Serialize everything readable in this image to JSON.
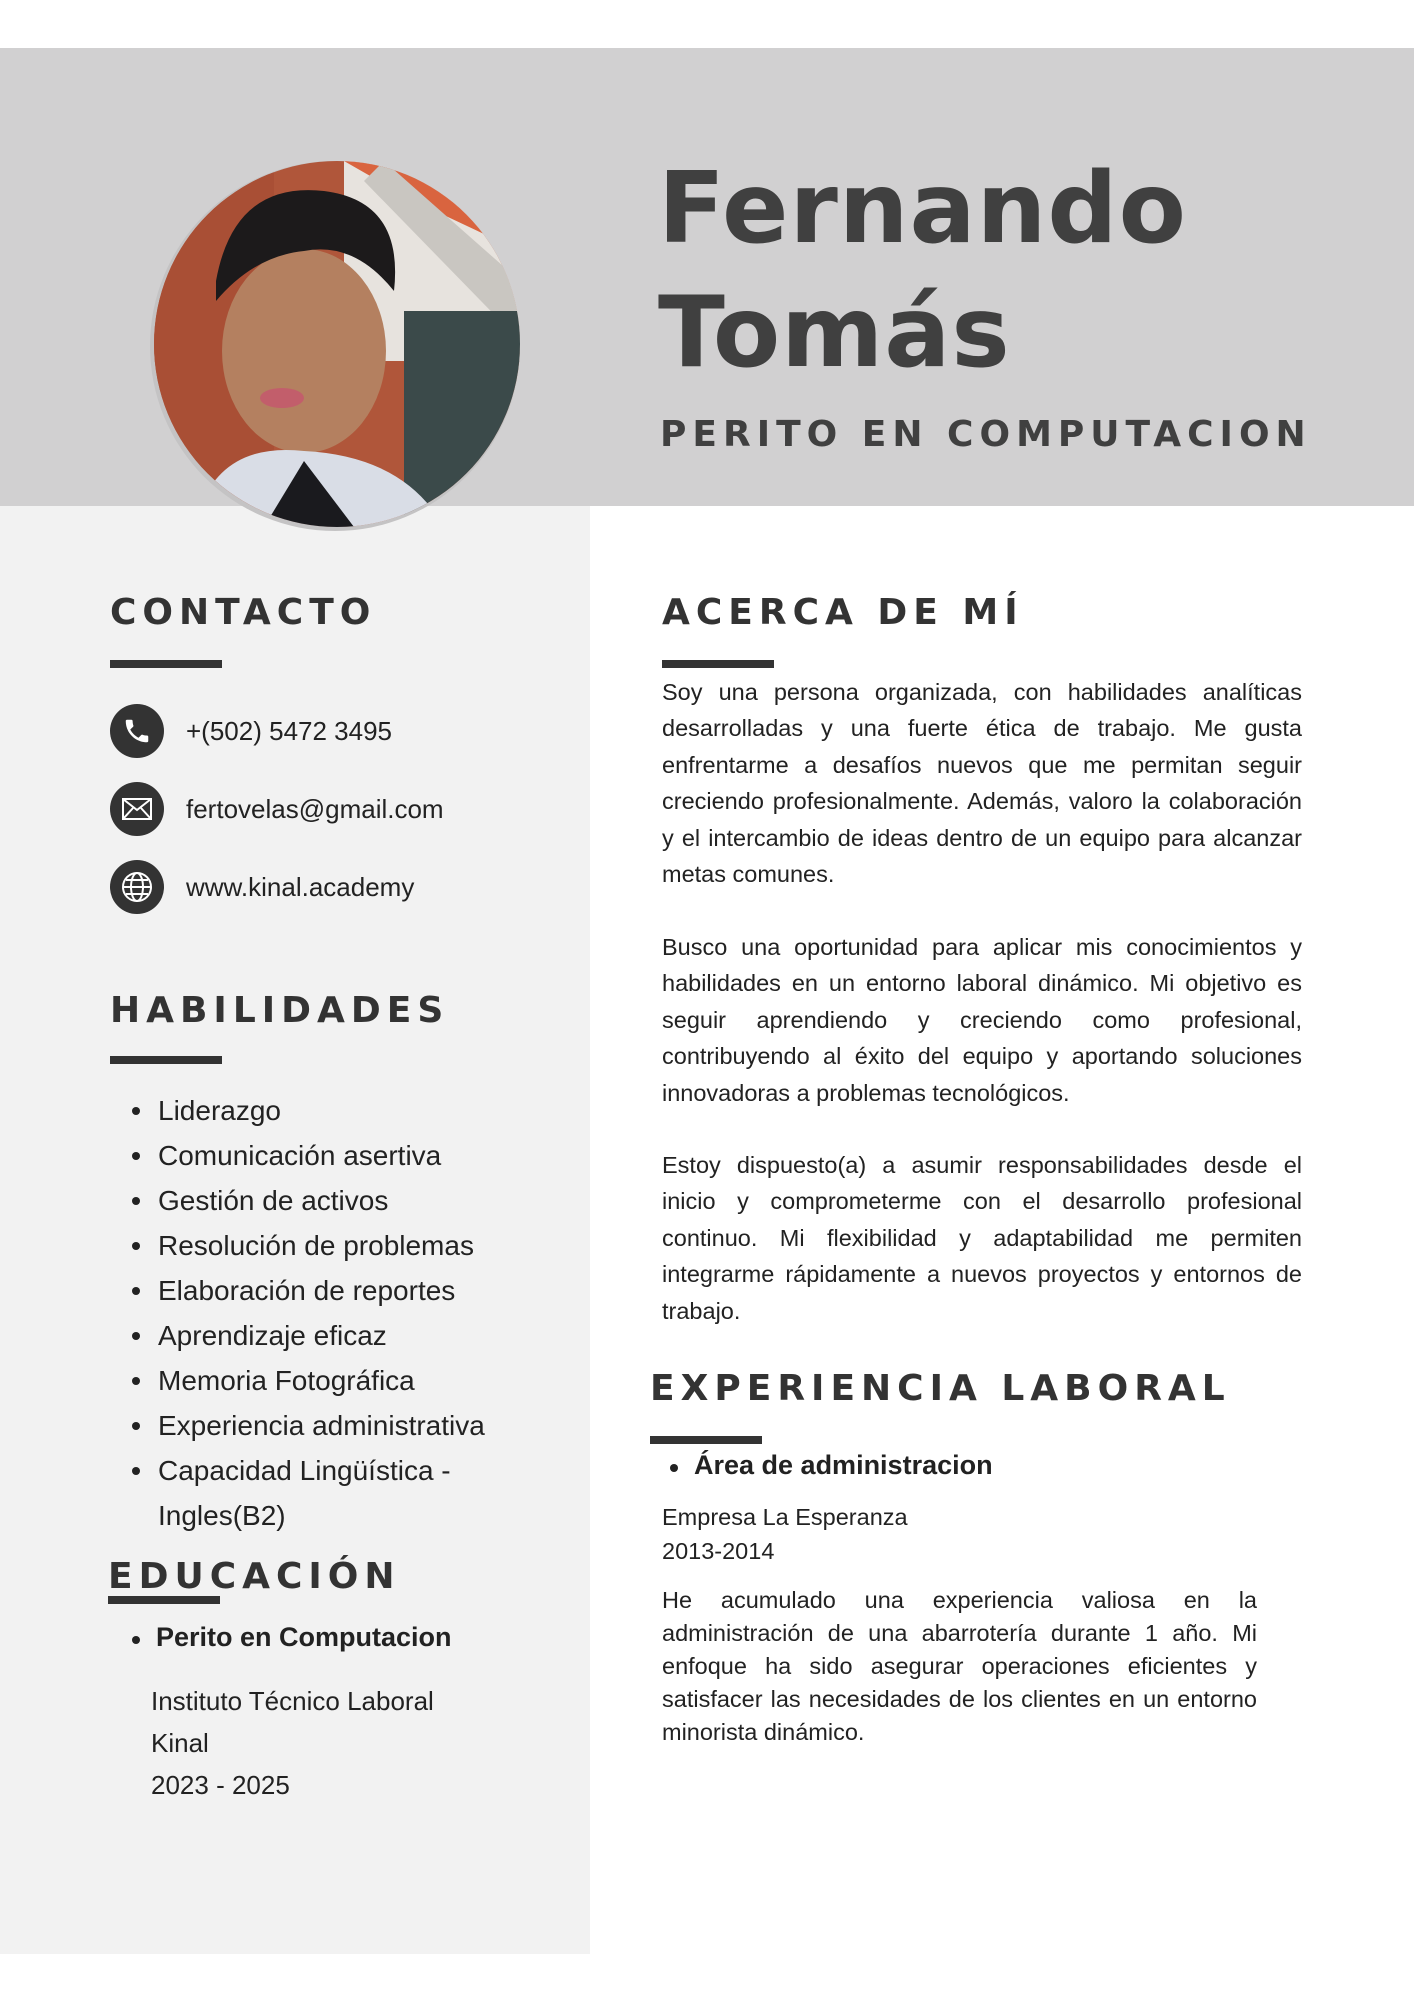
{
  "header": {
    "first_name": "Fernando",
    "last_name": "Tomás",
    "job_title": "PERITO EN COMPUTACION"
  },
  "contact": {
    "title": "CONTACTO",
    "phone": "+(502) 5472 3495",
    "email": "fertovelas@gmail.com",
    "website": "www.kinal.academy",
    "icons": [
      "phone-icon",
      "mail-icon",
      "globe-icon"
    ]
  },
  "skills": {
    "title": "HABILIDADES",
    "items": [
      "Liderazgo",
      "Comunicación asertiva",
      "Gestión de activos",
      "Resolución de problemas",
      "Elaboración de reportes",
      "Aprendizaje eficaz",
      "Memoria Fotográfica",
      "Experiencia administrativa",
      "Capacidad Lingüística -",
      "Ingles(B2)"
    ]
  },
  "education": {
    "title": "EDUCACIÓN",
    "degree": "Perito en Computacion",
    "institution_line1": "Instituto Técnico Laboral",
    "institution_line2": "Kinal",
    "years": "2023 - 2025"
  },
  "about": {
    "title": "ACERCA DE MÍ",
    "paragraphs": [
      "Soy una persona organizada, con habilidades analíticas desarrolladas y una fuerte ética de trabajo. Me gusta enfrentarme a desafíos nuevos que me permitan seguir creciendo profesionalmente. Además, valoro la colaboración y el intercambio de ideas dentro de un equipo para alcanzar metas comunes.",
      "Busco una oportunidad para aplicar mis conocimientos y habilidades en un entorno laboral dinámico. Mi objetivo es seguir aprendiendo y creciendo como profesional, contribuyendo al éxito del equipo y aportando soluciones innovadoras a problemas tecnológicos.",
      "Estoy dispuesto(a) a asumir responsabilidades desde el inicio y comprometerme con el desarrollo profesional continuo. Mi flexibilidad y adaptabilidad me permiten integrarme rápidamente a nuevos proyectos y entornos de trabajo."
    ]
  },
  "experience": {
    "title": "EXPERIENCIA LABORAL",
    "role": "Área de administracion",
    "company": "Empresa La Esperanza",
    "years": "2013-2014",
    "description": "He acumulado una experiencia valiosa en la administración de una abarrotería durante 1 año. Mi enfoque ha sido asegurar operaciones eficientes y satisfacer las necesidades de los clientes en un entorno minorista dinámico."
  },
  "colors": {
    "header_band": "#d1d0d1",
    "sidebar": "#f2f2f2",
    "heading_text": "#404040",
    "icon_circle": "#333333"
  }
}
